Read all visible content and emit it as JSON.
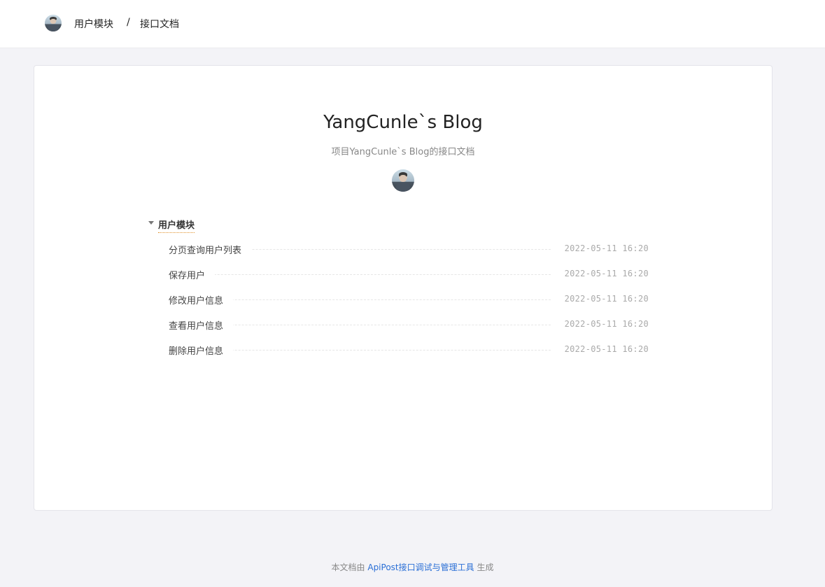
{
  "header": {
    "breadcrumb": [
      "用户模块",
      "/",
      "接口文档"
    ]
  },
  "doc": {
    "title": "YangCunle`s Blog",
    "subtitle": "项目YangCunle`s Blog的接口文档"
  },
  "groups": [
    {
      "title": "用户模块",
      "expanded": true,
      "items": [
        {
          "name": "分页查询用户列表",
          "date": "2022-05-11 16:20"
        },
        {
          "name": "保存用户",
          "date": "2022-05-11 16:20"
        },
        {
          "name": "修改用户信息",
          "date": "2022-05-11 16:20"
        },
        {
          "name": "查看用户信息",
          "date": "2022-05-11 16:20"
        },
        {
          "name": "删除用户信息",
          "date": "2022-05-11 16:20"
        }
      ]
    }
  ],
  "footer": {
    "prefix": "本文档由 ",
    "link": "ApiPost接口调试与管理工具",
    "suffix": " 生成"
  },
  "colors": {
    "background": "#f3f3f7",
    "link": "#2a6fd6",
    "group_underline": "#e0902a"
  }
}
